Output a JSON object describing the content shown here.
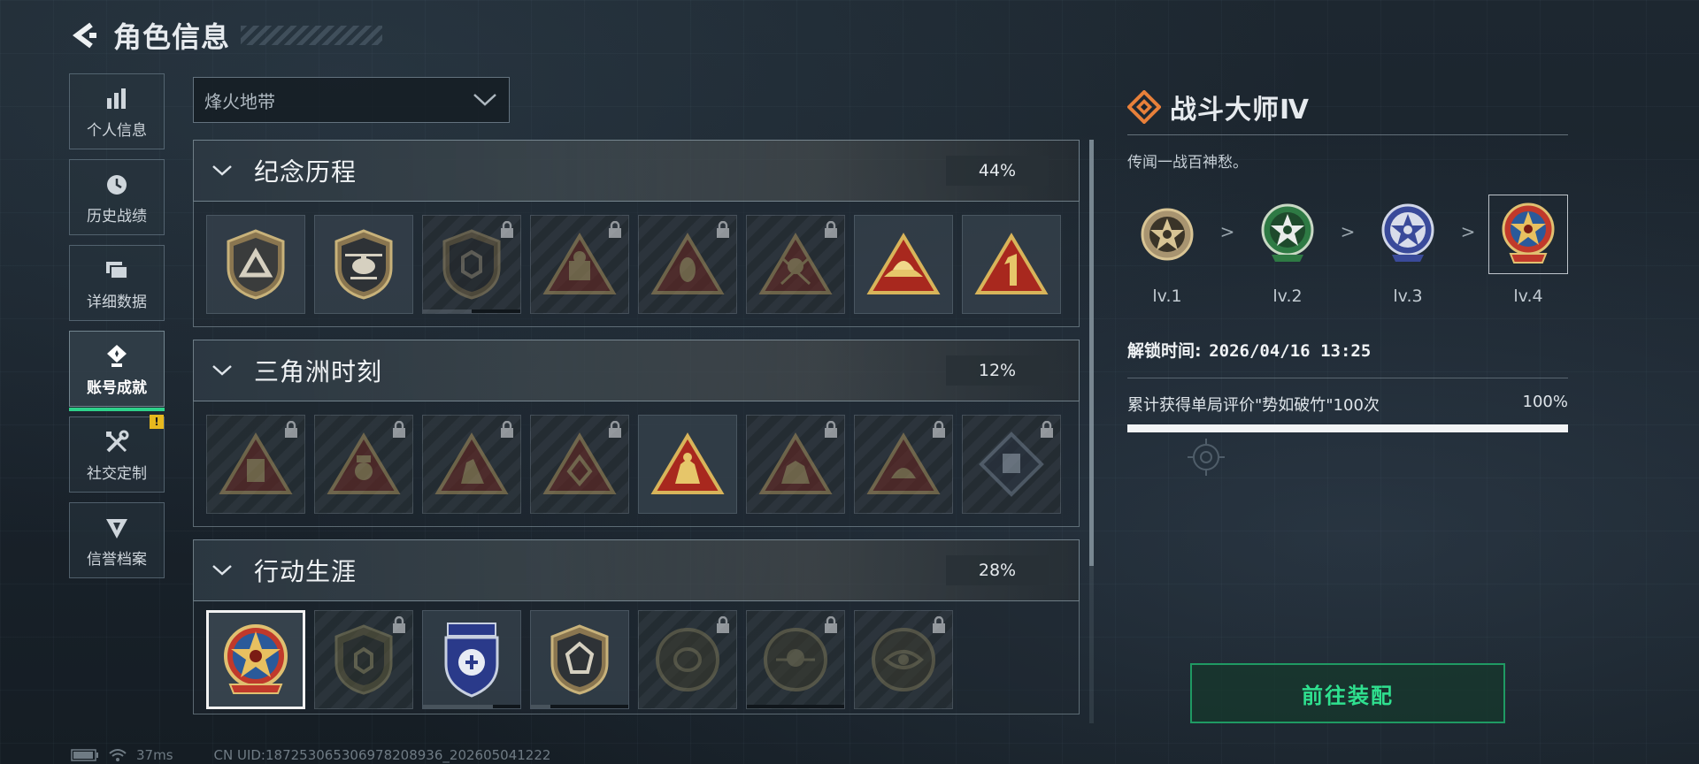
{
  "header": {
    "title": "角色信息"
  },
  "sidebar": {
    "items": [
      {
        "label": "个人信息",
        "icon": "bar-chart-icon",
        "active": false
      },
      {
        "label": "历史战绩",
        "icon": "clock-icon",
        "active": false
      },
      {
        "label": "详细数据",
        "icon": "cards-icon",
        "active": false
      },
      {
        "label": "账号成就",
        "icon": "achievement-icon",
        "active": true
      },
      {
        "label": "社交定制",
        "icon": "tools-icon",
        "active": false,
        "badge": "!"
      },
      {
        "label": "信誉档案",
        "icon": "emblem-icon",
        "active": false
      }
    ]
  },
  "season_select": {
    "value": "烽火地带"
  },
  "categories": [
    {
      "title": "纪念历程",
      "percent": "44%"
    },
    {
      "title": "三角洲时刻",
      "percent": "12%"
    },
    {
      "title": "行动生涯",
      "percent": "28%"
    }
  ],
  "detail": {
    "title": "战斗大师Ⅳ",
    "description": "传闻一战百神愁。",
    "levels": [
      "lv.1",
      "lv.2",
      "lv.3",
      "lv.4"
    ],
    "level_arrow": ">",
    "unlock_label": "解锁时间:",
    "unlock_time": "2026/04/16 13:25",
    "task_text": "累计获得单局评价\"势如破竹\"100次",
    "task_percent": "100%",
    "task_progress": 1.0,
    "equip_button": "前往装配"
  },
  "footer": {
    "ping": "37ms",
    "uid": "CN UID:18725306530697820893​6_202605041222"
  },
  "colors": {
    "accent_green": "#2ed18a",
    "badge_orange": "#e8803a",
    "alert_yellow": "#e6b81e"
  }
}
